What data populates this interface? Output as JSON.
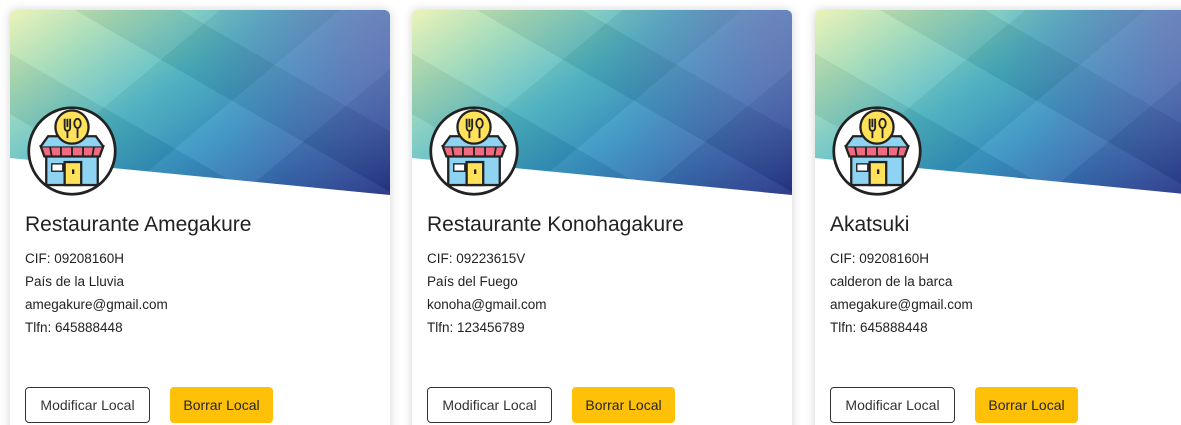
{
  "cards": [
    {
      "name": "Restaurante Amegakure",
      "cif": "CIF: 09208160H",
      "address": "País de la Lluvia",
      "email": "amegakure@gmail.com",
      "phone": "Tlfn: 645888448",
      "logo_icon": "restaurant-store-icon",
      "modify_label": "Modificar Local",
      "delete_label": "Borrar Local"
    },
    {
      "name": "Restaurante Konohagakure",
      "cif": "CIF: 09223615V",
      "address": "País del Fuego",
      "email": "konoha@gmail.com",
      "phone": "Tlfn: 123456789",
      "logo_icon": "restaurant-store-icon",
      "modify_label": "Modificar Local",
      "delete_label": "Borrar Local"
    },
    {
      "name": "Akatsuki",
      "cif": "CIF: 09208160H",
      "address": "calderon de la barca",
      "email": "amegakure@gmail.com",
      "phone": "Tlfn: 645888448",
      "logo_icon": "restaurant-store-icon",
      "modify_label": "Modificar Local",
      "delete_label": "Borrar Local"
    }
  ],
  "colors": {
    "delete_button": "#ffc107",
    "banner_start": "#e9f2b0",
    "banner_end": "#23328a"
  }
}
